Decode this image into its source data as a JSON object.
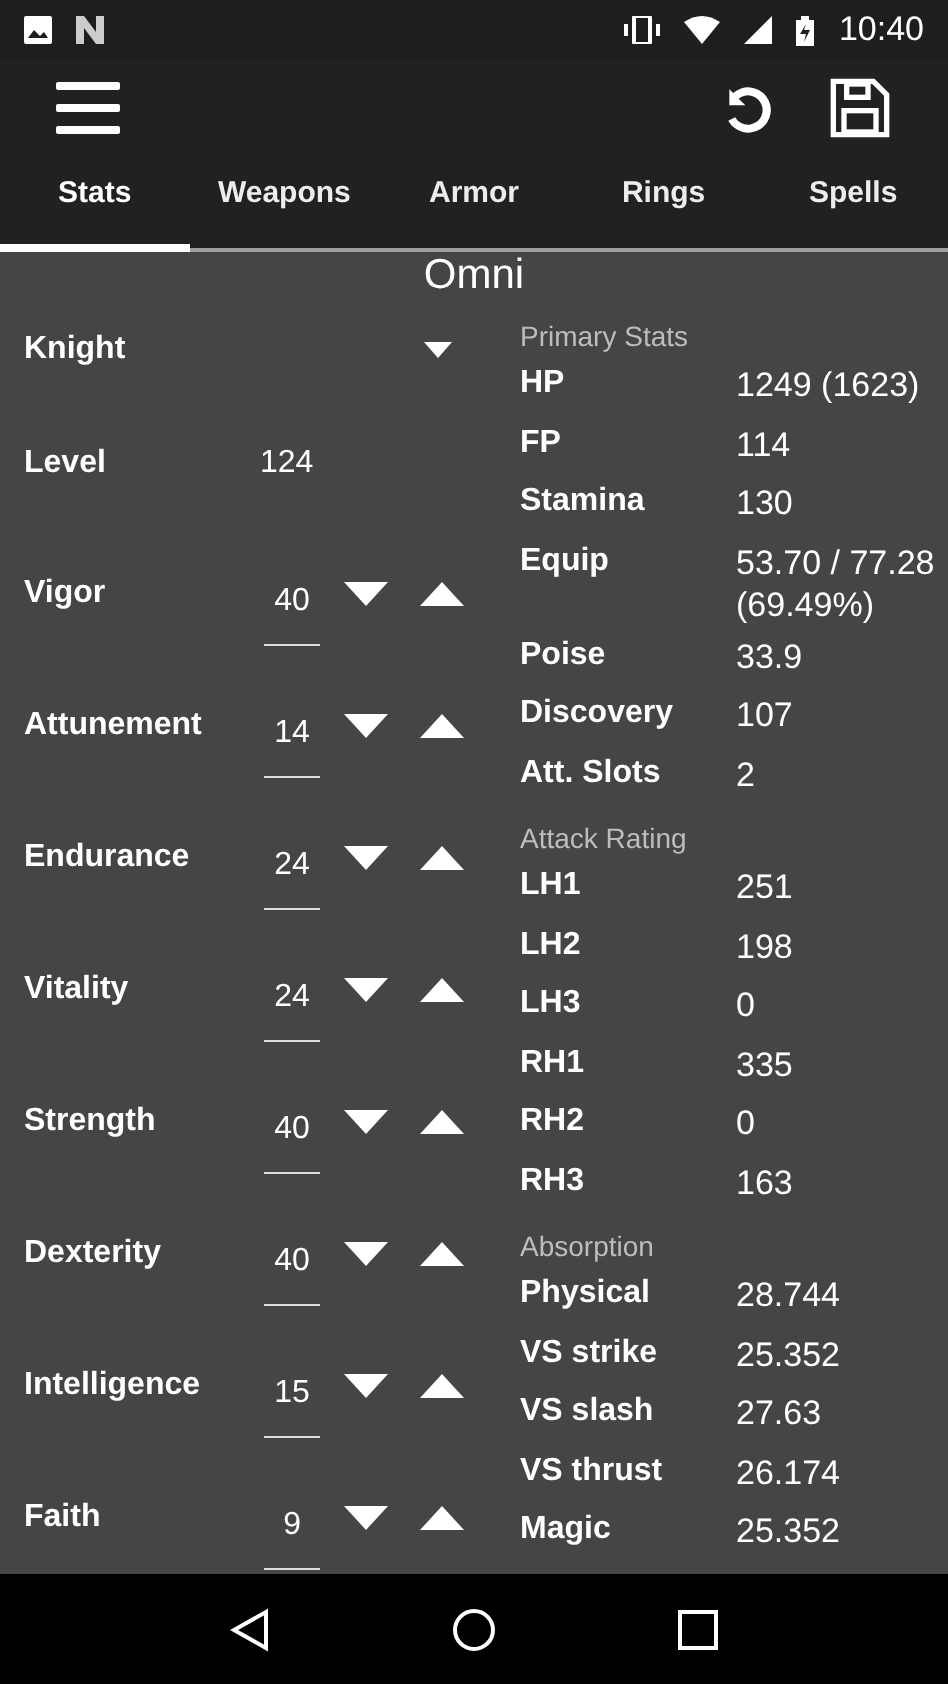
{
  "status_bar": {
    "time": "10:40"
  },
  "tabs": [
    {
      "label": "Stats",
      "selected": true
    },
    {
      "label": "Weapons",
      "selected": false
    },
    {
      "label": "Armor",
      "selected": false
    },
    {
      "label": "Rings",
      "selected": false
    },
    {
      "label": "Spells",
      "selected": false
    }
  ],
  "character": {
    "name": "Omni",
    "class": "Knight",
    "level_label": "Level",
    "level": "124",
    "attributes": [
      {
        "name": "Vigor",
        "value": "40"
      },
      {
        "name": "Attunement",
        "value": "14"
      },
      {
        "name": "Endurance",
        "value": "24"
      },
      {
        "name": "Vitality",
        "value": "24"
      },
      {
        "name": "Strength",
        "value": "40"
      },
      {
        "name": "Dexterity",
        "value": "40"
      },
      {
        "name": "Intelligence",
        "value": "15"
      },
      {
        "name": "Faith",
        "value": "9"
      }
    ]
  },
  "sections": [
    {
      "title": "Primary Stats",
      "rows": [
        {
          "label": "HP",
          "value": "1249 (1623)"
        },
        {
          "label": "FP",
          "value": "114"
        },
        {
          "label": "Stamina",
          "value": "130"
        },
        {
          "label": "Equip",
          "value": "53.70 / 77.28 (69.49%)"
        },
        {
          "label": "Poise",
          "value": "33.9"
        },
        {
          "label": "Discovery",
          "value": "107"
        },
        {
          "label": "Att. Slots",
          "value": "2"
        }
      ]
    },
    {
      "title": "Attack Rating",
      "rows": [
        {
          "label": "LH1",
          "value": "251"
        },
        {
          "label": "LH2",
          "value": "198"
        },
        {
          "label": "LH3",
          "value": "0"
        },
        {
          "label": "RH1",
          "value": "335"
        },
        {
          "label": "RH2",
          "value": "0"
        },
        {
          "label": "RH3",
          "value": "163"
        }
      ]
    },
    {
      "title": "Absorption",
      "rows": [
        {
          "label": "Physical",
          "value": "28.744"
        },
        {
          "label": "VS strike",
          "value": "25.352"
        },
        {
          "label": "VS slash",
          "value": "27.63"
        },
        {
          "label": "VS thrust",
          "value": "26.174"
        },
        {
          "label": "Magic",
          "value": "25.352"
        }
      ]
    }
  ]
}
